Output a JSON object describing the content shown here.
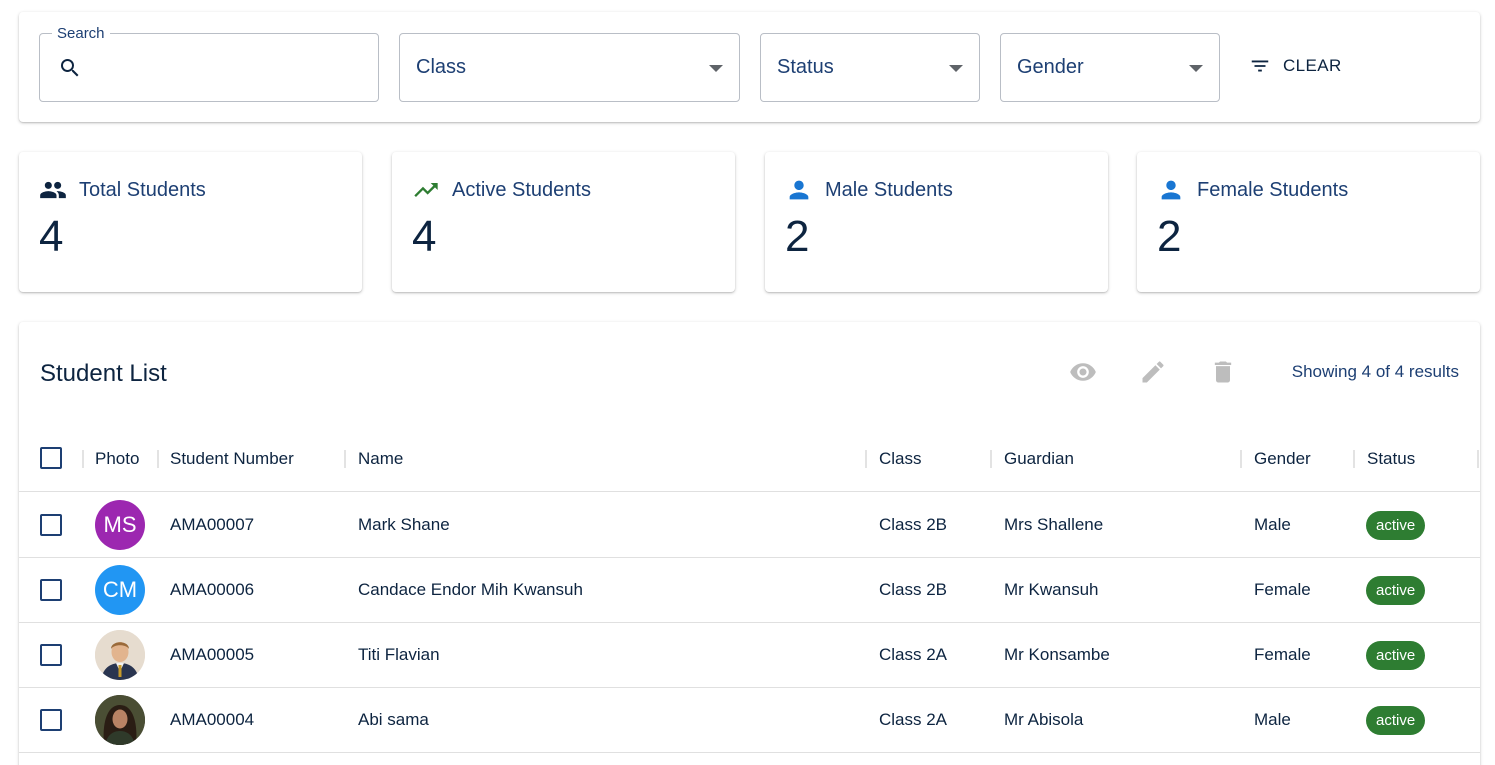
{
  "filters": {
    "search_label": "Search",
    "class_label": "Class",
    "status_label": "Status",
    "gender_label": "Gender",
    "clear_label": "CLEAR"
  },
  "stats": [
    {
      "title": "Total Students",
      "value": "4",
      "icon": "group-icon",
      "color": "#0d2440"
    },
    {
      "title": "Active Students",
      "value": "4",
      "icon": "trending-up-icon",
      "color": "#2e7d32"
    },
    {
      "title": "Male Students",
      "value": "2",
      "icon": "person-icon",
      "color": "#1976d2"
    },
    {
      "title": "Female Students",
      "value": "2",
      "icon": "person-icon",
      "color": "#1976d2"
    }
  ],
  "list": {
    "title": "Student List",
    "results": "Showing 4 of 4 results",
    "columns": [
      "Photo",
      "Student Number",
      "Name",
      "Class",
      "Guardian",
      "Gender",
      "Status"
    ],
    "rows": [
      {
        "initials": "MS",
        "avatar_color": "#9c27b0",
        "number": "AMA00007",
        "name": "Mark Shane",
        "class": "Class 2B",
        "guardian": "Mrs Shallene",
        "gender": "Male",
        "status": "active"
      },
      {
        "initials": "CM",
        "avatar_color": "#2196f3",
        "number": "AMA00006",
        "name": "Candace Endor Mih Kwansuh",
        "class": "Class 2B",
        "guardian": "Mr Kwansuh",
        "gender": "Female",
        "status": "active"
      },
      {
        "initials": "",
        "avatar_color": "#c9b8a6",
        "number": "AMA00005",
        "name": "Titi Flavian",
        "class": "Class 2A",
        "guardian": "Mr Konsambe",
        "gender": "Female",
        "status": "active"
      },
      {
        "initials": "",
        "avatar_color": "#3b3f2f",
        "number": "AMA00004",
        "name": "Abi sama",
        "class": "Class 2A",
        "guardian": "Mr Abisola",
        "gender": "Male",
        "status": "active"
      }
    ]
  },
  "colors": {
    "primary": "#1d3f73",
    "success": "#2e7d32",
    "icon_disabled": "#bdbdbd"
  }
}
